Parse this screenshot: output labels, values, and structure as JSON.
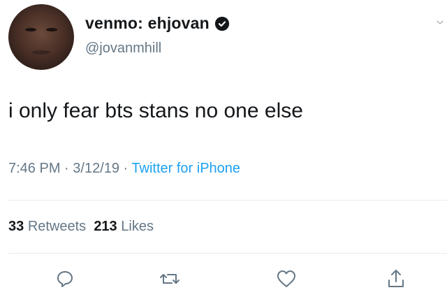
{
  "author": {
    "display_name": "venmo: ehjovan",
    "verified_glyph": "❯",
    "handle": "@jovanmhill",
    "avatar_icon": "avatar-photo"
  },
  "tweet": {
    "text": "i only fear bts stans no one else"
  },
  "meta": {
    "time": "7:46 PM",
    "separator": " · ",
    "date": "3/12/19",
    "source": "Twitter for iPhone"
  },
  "stats": {
    "retweets_count": "33",
    "retweets_label": "Retweets",
    "likes_count": "213",
    "likes_label": "Likes"
  },
  "actions": [
    {
      "icon": "reply-icon"
    },
    {
      "icon": "retweet-icon"
    },
    {
      "icon": "like-icon"
    },
    {
      "icon": "share-icon"
    }
  ],
  "colors": {
    "text": "#14171a",
    "secondary": "#657786",
    "link": "#1da1f2",
    "divider": "#e6ecf0"
  }
}
